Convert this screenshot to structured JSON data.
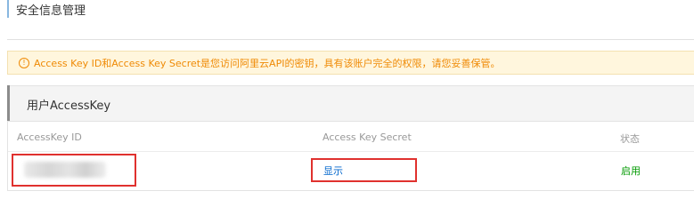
{
  "page": {
    "title": "安全信息管理"
  },
  "alert": {
    "icon": "alert-circle-icon",
    "message": "Access Key ID和Access Key Secret是您访问阿里云API的密钥，具有该账户完全的权限，请您妥善保管。",
    "color": "#ef8a05",
    "background": "#fff6dd"
  },
  "panel": {
    "title": "用户AccessKey",
    "columns": [
      "AccessKey ID",
      "Access Key Secret",
      "状态"
    ],
    "rows": [
      {
        "access_key_id": "",
        "secret_action": "显示",
        "status": "启用"
      }
    ]
  },
  "colors": {
    "link": "#0066cc",
    "status_enabled": "#009900",
    "highlight": "#e0312e"
  }
}
